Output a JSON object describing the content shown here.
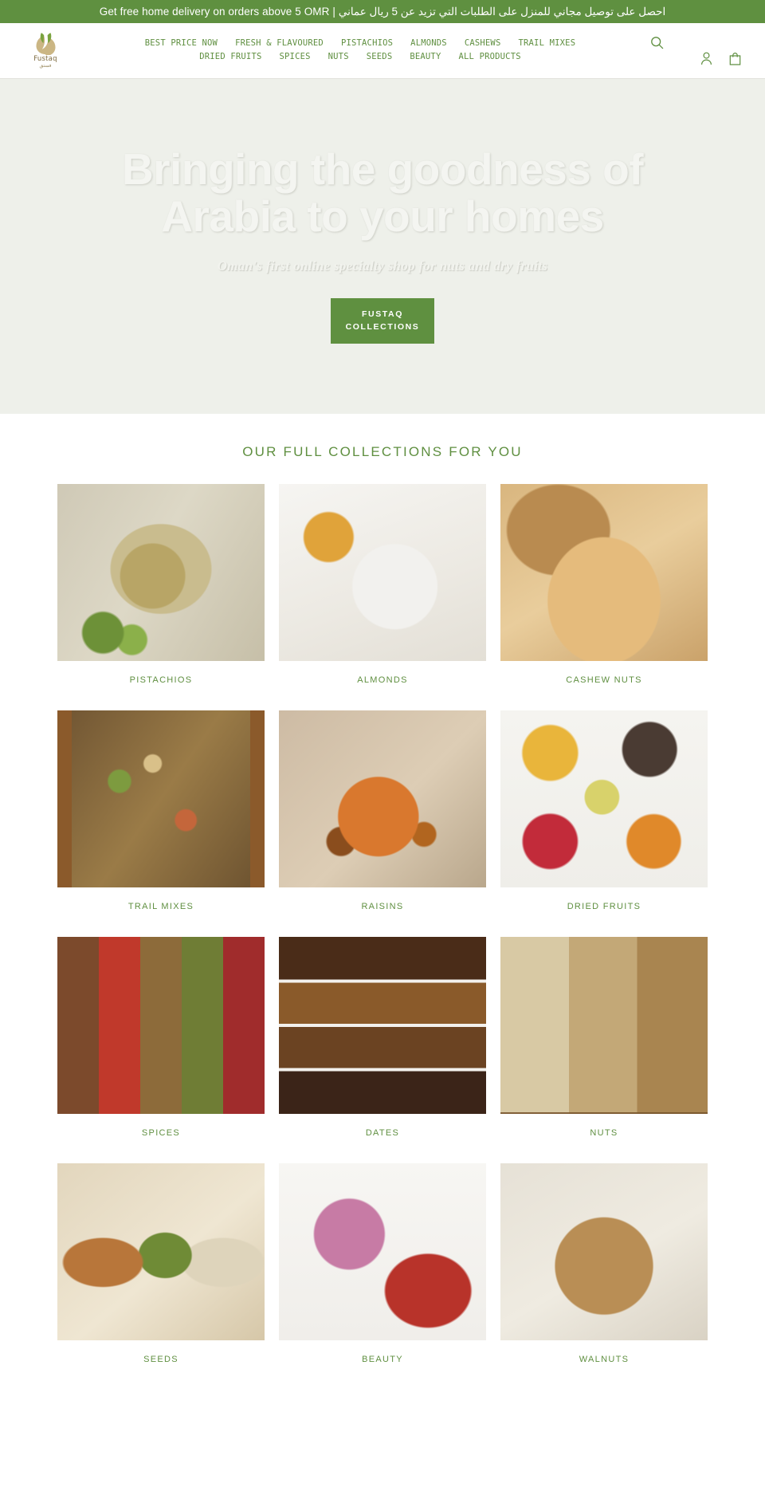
{
  "announcement": {
    "text": "Get free home delivery on orders above 5 OMR | احصل على توصيل مجاني للمنزل على الطلبات التي تزيد عن 5 ريال عماني",
    "bg": "#5f9040"
  },
  "header": {
    "logo": {
      "word": "Fustaq",
      "arabic": "فستق",
      "icon": "pistachio-logo-icon"
    },
    "nav_row1": [
      {
        "label": "BEST PRICE NOW"
      },
      {
        "label": "FRESH & FLAVOURED"
      },
      {
        "label": "PISTACHIOS"
      },
      {
        "label": "ALMONDS"
      },
      {
        "label": "CASHEWS"
      },
      {
        "label": "TRAIL MIXES"
      }
    ],
    "nav_row2": [
      {
        "label": "DRIED FRUITS"
      },
      {
        "label": "SPICES"
      },
      {
        "label": "NUTS"
      },
      {
        "label": "SEEDS"
      },
      {
        "label": "BEAUTY"
      },
      {
        "label": "ALL PRODUCTS"
      }
    ],
    "icons": {
      "search": "search-icon",
      "account": "account-icon",
      "cart": "cart-icon"
    },
    "accent_color": "#5f8f40"
  },
  "hero": {
    "title": "Bringing the goodness of Arabia to your homes",
    "subtitle": "Oman's first online specialty shop for nuts and dry fruits",
    "button_label": "FUSTAQ COLLECTIONS",
    "bg": "#eef0ea"
  },
  "collections": {
    "title": "OUR FULL COLLECTIONS FOR YOU",
    "items": [
      {
        "label": "PISTACHIOS",
        "image": "pistachios-in-wooden-bowl"
      },
      {
        "label": "ALMONDS",
        "image": "almonds-in-white-bowl-with-honey"
      },
      {
        "label": "CASHEW NUTS",
        "image": "cashews-spilling-from-sack"
      },
      {
        "label": "TRAIL MIXES",
        "image": "trail-mix-in-wooden-tray"
      },
      {
        "label": "RAISINS",
        "image": "raisins-in-orange-bowl"
      },
      {
        "label": "DRIED FRUITS",
        "image": "assorted-dried-fruits-in-bowls"
      },
      {
        "label": "SPICES",
        "image": "spice-grid-swatches"
      },
      {
        "label": "DATES",
        "image": "assorted-dates-grid"
      },
      {
        "label": "NUTS",
        "image": "mixed-nuts-in-wooden-box"
      },
      {
        "label": "SEEDS",
        "image": "seeds-in-wooden-scoops"
      },
      {
        "label": "BEAUTY",
        "image": "pink-rose-with-saffron"
      },
      {
        "label": "WALNUTS",
        "image": "walnuts-in-wooden-bowl"
      }
    ]
  }
}
